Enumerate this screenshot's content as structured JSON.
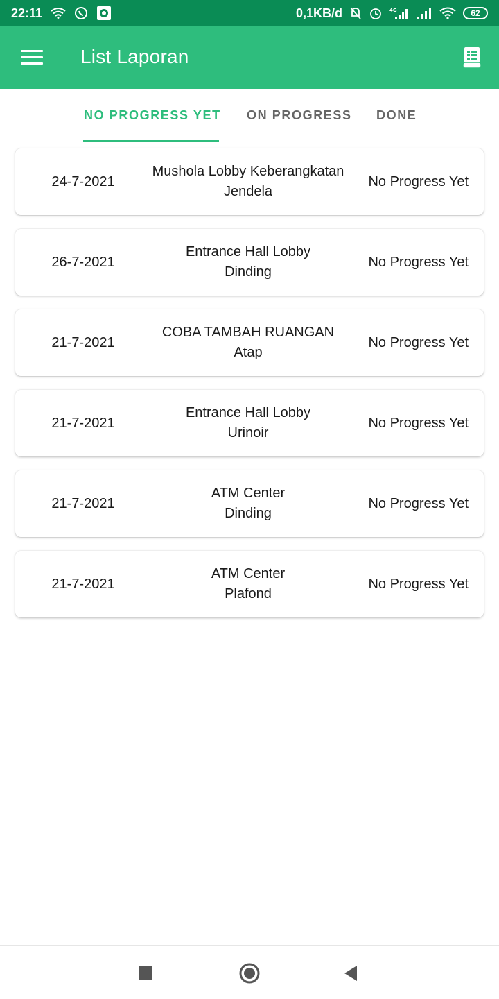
{
  "status_bar": {
    "time": "22:11",
    "network_speed": "0,1KB/d",
    "network_type": "4G",
    "battery": "62",
    "icons_left": [
      "wifi-icon",
      "whatsapp-icon",
      "screen-record-icon"
    ],
    "icons_right": [
      "mute-bell-icon",
      "alarm-icon",
      "signal-4g-icon",
      "signal-icon",
      "wifi-icon",
      "battery-icon"
    ]
  },
  "app_bar": {
    "title": "List Laporan",
    "menu_icon": "hamburger-menu-icon",
    "action_icon": "report-document-icon"
  },
  "tabs": [
    {
      "label": "NO PROGRESS YET",
      "active": true
    },
    {
      "label": "ON PROGRESS",
      "active": false
    },
    {
      "label": "DONE",
      "active": false
    }
  ],
  "reports": [
    {
      "date": "24-7-2021",
      "location": "Mushola Lobby Keberangkatan",
      "item": "Jendela",
      "status": "No Progress Yet"
    },
    {
      "date": "26-7-2021",
      "location": "Entrance Hall Lobby",
      "item": "Dinding",
      "status": "No Progress Yet"
    },
    {
      "date": "21-7-2021",
      "location": "COBA TAMBAH RUANGAN",
      "item": "Atap",
      "status": "No Progress Yet"
    },
    {
      "date": "21-7-2021",
      "location": "Entrance Hall Lobby",
      "item": "Urinoir",
      "status": "No Progress Yet"
    },
    {
      "date": "21-7-2021",
      "location": "ATM Center",
      "item": "Dinding",
      "status": "No Progress Yet"
    },
    {
      "date": "21-7-2021",
      "location": "ATM Center",
      "item": "Plafond",
      "status": "No Progress Yet"
    }
  ],
  "nav_bar": {
    "buttons": [
      "recents-square-icon",
      "home-circle-icon",
      "back-triangle-icon"
    ]
  },
  "colors": {
    "status_bar": "#0a8c55",
    "app_bar": "#2ebd7d",
    "accent": "#2ebd7d",
    "tab_inactive": "#666666"
  }
}
